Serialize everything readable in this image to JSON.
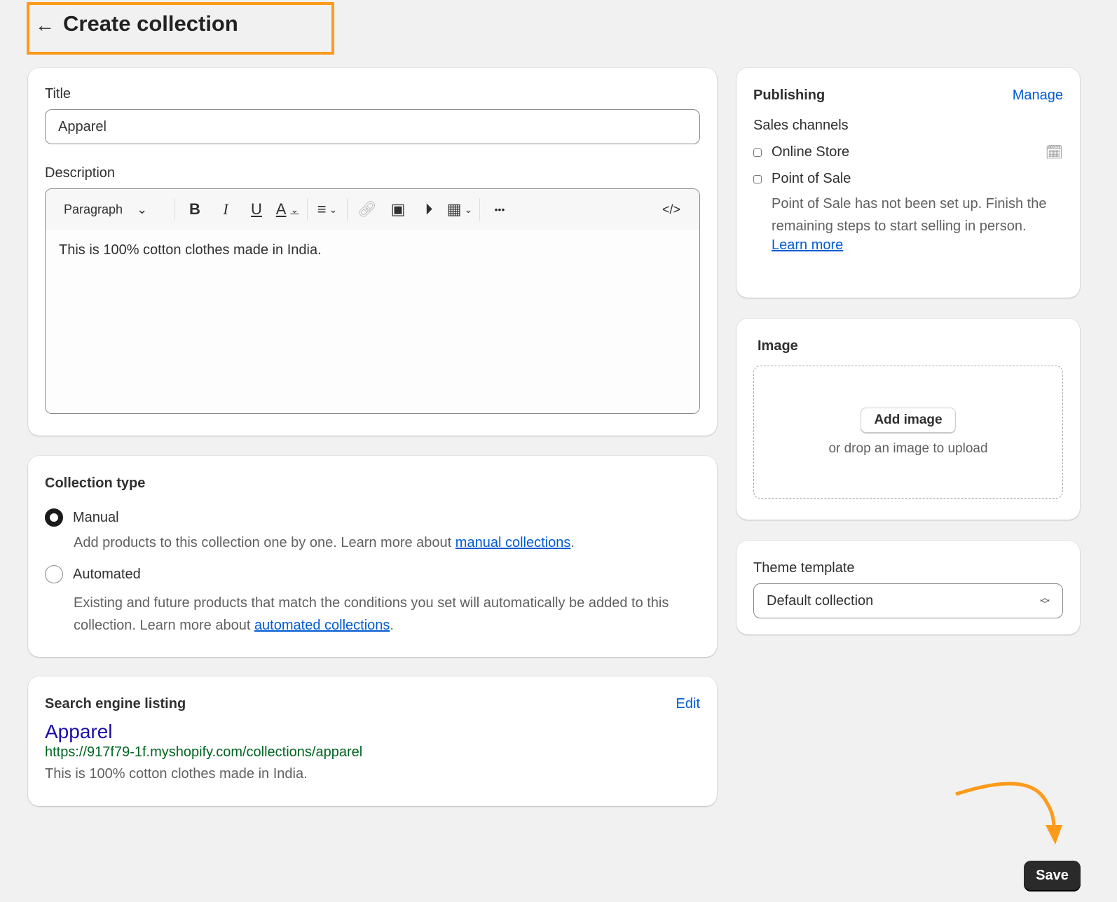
{
  "header": {
    "back": "←",
    "title": "Create collection"
  },
  "main": {
    "title_label": "Title",
    "title_value": "Apparel",
    "description_label": "Description",
    "toolbar": {
      "format": "Paragraph",
      "bold": "B",
      "italic": "I",
      "underline": "U",
      "color": "A",
      "more": "•••",
      "code": "</>"
    },
    "description_value": "This is 100% cotton clothes made in India."
  },
  "collection_type": {
    "heading": "Collection type",
    "manual": {
      "label": "Manual",
      "desc": "Add products to this collection one by one. Learn more about ",
      "link": "manual collections",
      "selected": true
    },
    "automated": {
      "label": "Automated",
      "desc": "Existing and future products that match the conditions you set will automatically be added to this collection. Learn more about ",
      "link": "automated collections",
      "selected": false
    }
  },
  "seo": {
    "heading": "Search engine listing",
    "edit": "Edit",
    "title": "Apparel",
    "url": "https://917f79-1f.myshopify.com/collections/apparel",
    "description": "This is 100% cotton clothes made in India."
  },
  "publishing": {
    "heading": "Publishing",
    "manage": "Manage",
    "channels_label": "Sales channels",
    "channels": [
      "Online Store",
      "Point of Sale"
    ],
    "pos_note": "Point of Sale has not been set up. Finish the remaining steps to start selling in person.",
    "learn_more": "Learn more"
  },
  "image": {
    "heading": "Image",
    "add": "Add image",
    "hint": "or drop an image to upload"
  },
  "theme": {
    "label": "Theme template",
    "value": "Default collection"
  },
  "save": "Save",
  "colors": {
    "accent": "#ff9a1a",
    "link": "#005bd3",
    "seo_title": "#1a0dab",
    "seo_url": "#006621"
  }
}
